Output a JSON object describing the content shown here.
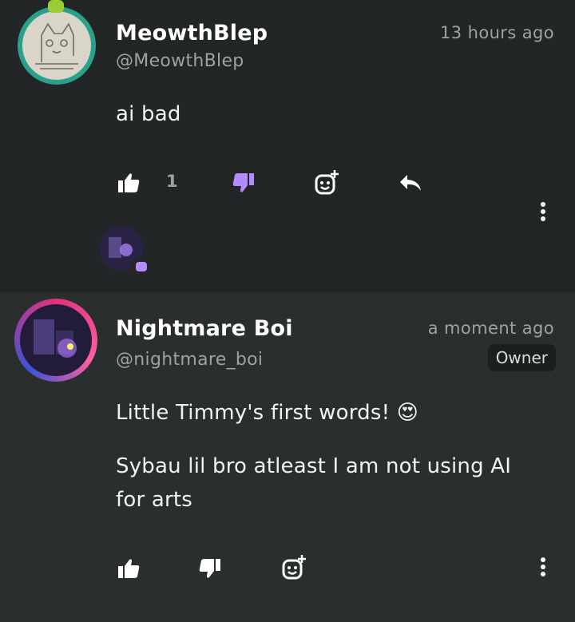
{
  "comments": [
    {
      "author": "MeowthBlep",
      "handle": "@MeowthBlep",
      "timestamp": "13 hours ago",
      "text": "ai bad",
      "like_count": "1",
      "icons": [
        "thumbs-up-icon",
        "thumbs-down-icon",
        "add-reaction-icon",
        "reply-icon",
        "more-options-icon"
      ]
    },
    {
      "author": "Nightmare Boi",
      "handle": "@nightmare_boi",
      "timestamp": "a moment ago",
      "badge": "Owner",
      "text": "Little Timmy's first words! 😍",
      "text2_line1": "Sybau lil bro atleast I am not using AI",
      "text2_line2": "for arts",
      "icons": [
        "thumbs-up-icon",
        "thumbs-down-icon",
        "add-reaction-icon",
        "more-options-icon"
      ]
    }
  ],
  "colors": {
    "background": "#222627",
    "background_alt": "#2a2e2f",
    "text": "#ffffff",
    "muted": "#9ea2a3",
    "dislike_active": "#b48cff",
    "avatar_ring_1": "#2aa08c",
    "avatar_ring_2": "#e0337a"
  }
}
